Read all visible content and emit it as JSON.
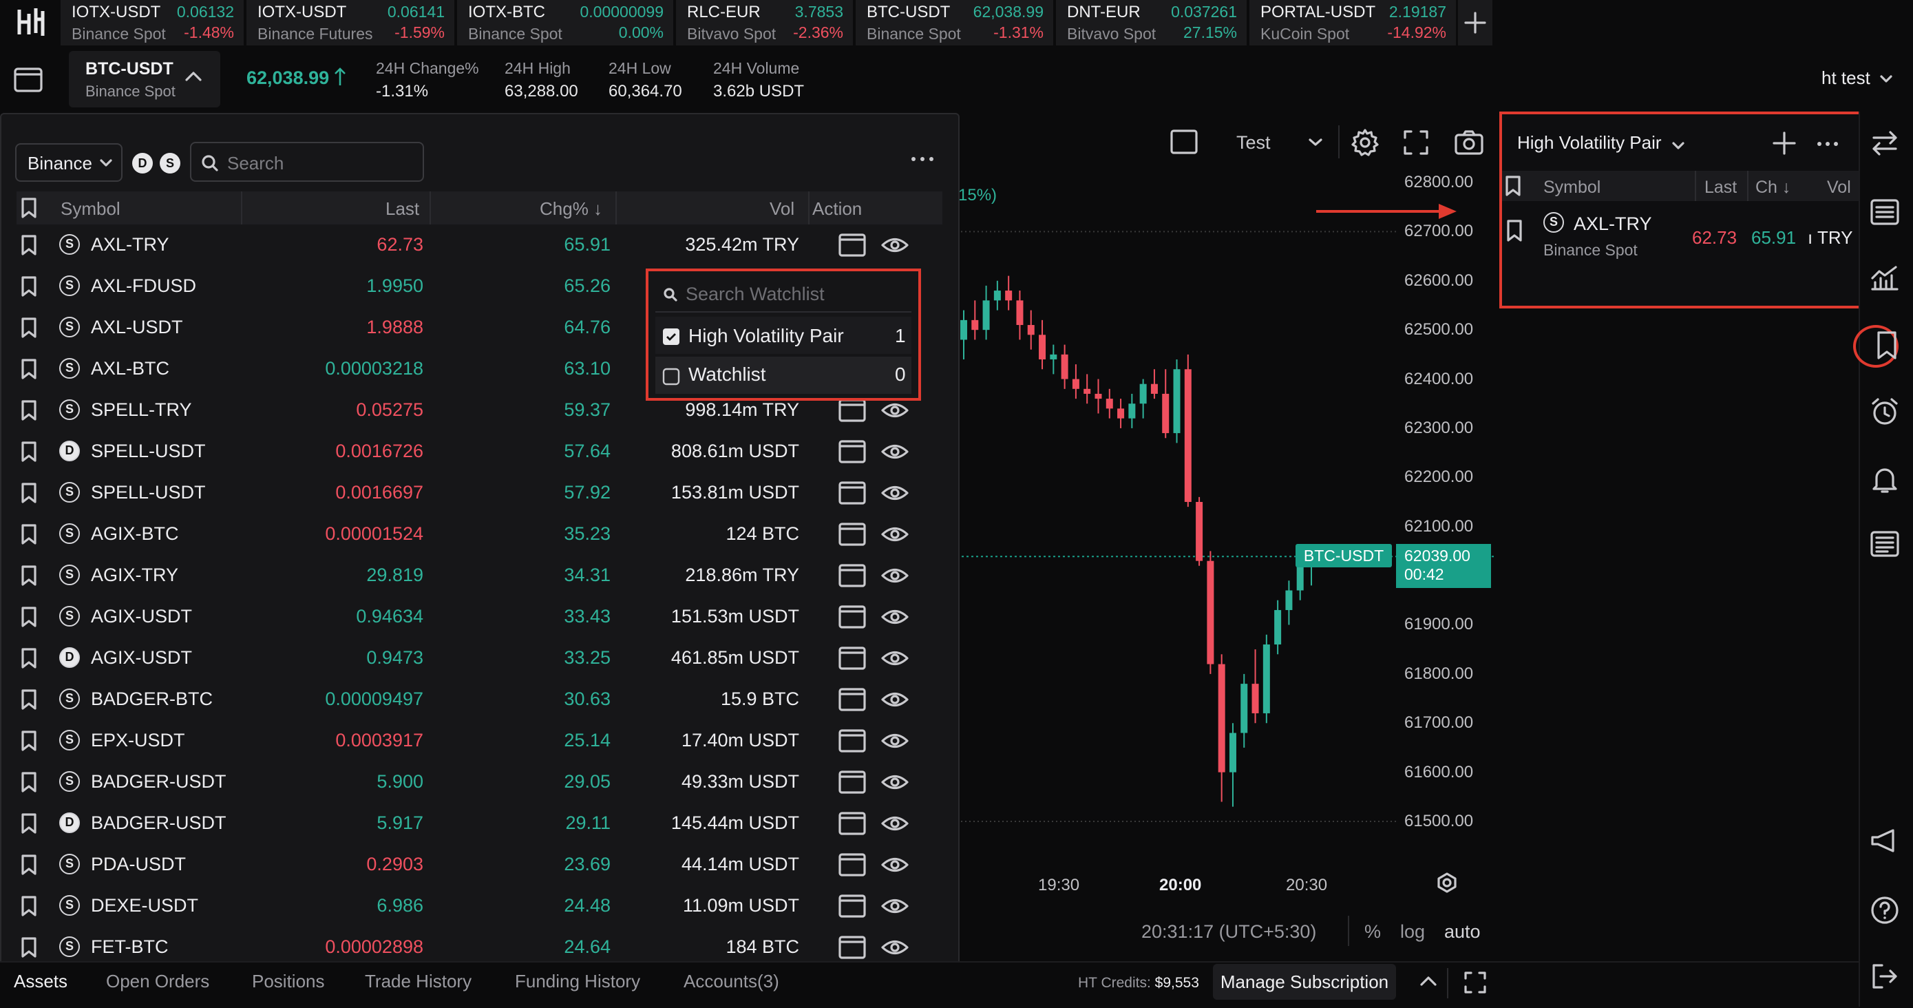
{
  "tickers": [
    {
      "name": "IOTX-USDT",
      "price": "0.06132",
      "exchange": "Binance Spot",
      "change": "-1.48%",
      "dir": "down"
    },
    {
      "name": "IOTX-USDT",
      "price": "0.06141",
      "exchange": "Binance Futures",
      "change": "-1.59%",
      "dir": "down"
    },
    {
      "name": "IOTX-BTC",
      "price": "0.00000099",
      "exchange": "Binance Spot",
      "change": "0.00%",
      "dir": "up"
    },
    {
      "name": "RLC-EUR",
      "price": "3.7853",
      "exchange": "Bitvavo Spot",
      "change": "-2.36%",
      "dir": "down"
    },
    {
      "name": "BTC-USDT",
      "price": "62,038.99",
      "exchange": "Binance Spot",
      "change": "-1.31%",
      "dir": "down"
    },
    {
      "name": "DNT-EUR",
      "price": "0.037261",
      "exchange": "Bitvavo Spot",
      "change": "27.15%",
      "dir": "up"
    },
    {
      "name": "PORTAL-USDT",
      "price": "2.19187",
      "exchange": "KuCoin Spot",
      "change": "-14.92%",
      "dir": "down"
    }
  ],
  "header": {
    "pair": "BTC-USDT",
    "pair_exchange": "Binance Spot",
    "price": "62,038.99",
    "stats": [
      {
        "label": "24H Change%",
        "value": "-1.31%"
      },
      {
        "label": "24H High",
        "value": "63,288.00"
      },
      {
        "label": "24H Low",
        "value": "60,364.70"
      },
      {
        "label": "24H Volume",
        "value": "3.62b USDT"
      }
    ],
    "user": "ht test"
  },
  "market": {
    "exchange": "Binance",
    "badge_d": "D",
    "badge_s": "S",
    "search_placeholder": "Search",
    "columns": {
      "symbol": "Symbol",
      "last": "Last",
      "chg": "Chg% ↓",
      "vol": "Vol",
      "action": "Action"
    },
    "rows": [
      {
        "src": "S",
        "symbol": "AXL-TRY",
        "last": "62.73",
        "last_dir": "down",
        "chg": "65.91",
        "vol": "325.42m TRY"
      },
      {
        "src": "S",
        "symbol": "AXL-FDUSD",
        "last": "1.9950",
        "last_dir": "up",
        "chg": "65.26",
        "vol": ""
      },
      {
        "src": "S",
        "symbol": "AXL-USDT",
        "last": "1.9888",
        "last_dir": "down",
        "chg": "64.76",
        "vol": ""
      },
      {
        "src": "S",
        "symbol": "AXL-BTC",
        "last": "0.00003218",
        "last_dir": "up",
        "chg": "63.10",
        "vol": ""
      },
      {
        "src": "S",
        "symbol": "SPELL-TRY",
        "last": "0.05275",
        "last_dir": "down",
        "chg": "59.37",
        "vol": "998.14m TRY"
      },
      {
        "src": "D",
        "symbol": "SPELL-USDT",
        "last": "0.0016726",
        "last_dir": "down",
        "chg": "57.64",
        "vol": "808.61m USDT"
      },
      {
        "src": "S",
        "symbol": "SPELL-USDT",
        "last": "0.0016697",
        "last_dir": "down",
        "chg": "57.92",
        "vol": "153.81m USDT"
      },
      {
        "src": "S",
        "symbol": "AGIX-BTC",
        "last": "0.00001524",
        "last_dir": "down",
        "chg": "35.23",
        "vol": "124 BTC"
      },
      {
        "src": "S",
        "symbol": "AGIX-TRY",
        "last": "29.819",
        "last_dir": "up",
        "chg": "34.31",
        "vol": "218.86m TRY"
      },
      {
        "src": "S",
        "symbol": "AGIX-USDT",
        "last": "0.94634",
        "last_dir": "up",
        "chg": "33.43",
        "vol": "151.53m USDT"
      },
      {
        "src": "D",
        "symbol": "AGIX-USDT",
        "last": "0.9473",
        "last_dir": "up",
        "chg": "33.25",
        "vol": "461.85m USDT"
      },
      {
        "src": "S",
        "symbol": "BADGER-BTC",
        "last": "0.00009497",
        "last_dir": "up",
        "chg": "30.63",
        "vol": "15.9 BTC"
      },
      {
        "src": "S",
        "symbol": "EPX-USDT",
        "last": "0.0003917",
        "last_dir": "down",
        "chg": "25.14",
        "vol": "17.40m USDT"
      },
      {
        "src": "S",
        "symbol": "BADGER-USDT",
        "last": "5.900",
        "last_dir": "up",
        "chg": "29.05",
        "vol": "49.33m USDT"
      },
      {
        "src": "D",
        "symbol": "BADGER-USDT",
        "last": "5.917",
        "last_dir": "up",
        "chg": "29.11",
        "vol": "145.44m USDT"
      },
      {
        "src": "S",
        "symbol": "PDA-USDT",
        "last": "0.2903",
        "last_dir": "down",
        "chg": "23.69",
        "vol": "44.14m USDT"
      },
      {
        "src": "S",
        "symbol": "DEXE-USDT",
        "last": "6.986",
        "last_dir": "up",
        "chg": "24.48",
        "vol": "11.09m USDT"
      },
      {
        "src": "S",
        "symbol": "FET-BTC",
        "last": "0.00002898",
        "last_dir": "down",
        "chg": "24.64",
        "vol": "184 BTC"
      }
    ]
  },
  "watchlist_popup": {
    "search_placeholder": "Search Watchlist",
    "items": [
      {
        "label": "High Volatility Pair",
        "count": "1",
        "checked": true
      },
      {
        "label": "Watchlist",
        "count": "0",
        "checked": false
      }
    ]
  },
  "chart_toolbar": {
    "layout_name": "Test"
  },
  "chart_data": {
    "type": "candlestick",
    "symbol": "BTC-USDT",
    "y_ticks": [
      "62800.00",
      "62700.00",
      "62600.00",
      "62500.00",
      "62400.00",
      "62300.00",
      "62200.00",
      "62100.00",
      "61900.00",
      "61800.00",
      "61700.00",
      "61600.00",
      "61500.00"
    ],
    "ylim": [
      61470,
      62830
    ],
    "x_ticks": [
      "19:30",
      "20:00",
      "20:30"
    ],
    "current_price": "62039.00",
    "countdown": "00:42",
    "partial_label": "15%)",
    "ohlc": [
      [
        62480,
        62540,
        62440,
        62520
      ],
      [
        62520,
        62560,
        62480,
        62500
      ],
      [
        62500,
        62590,
        62480,
        62560
      ],
      [
        62560,
        62600,
        62540,
        62580
      ],
      [
        62580,
        62610,
        62540,
        62560
      ],
      [
        62560,
        62580,
        62480,
        62510
      ],
      [
        62510,
        62540,
        62460,
        62490
      ],
      [
        62490,
        62520,
        62420,
        62440
      ],
      [
        62440,
        62470,
        62410,
        62450
      ],
      [
        62450,
        62470,
        62380,
        62400
      ],
      [
        62400,
        62430,
        62360,
        62380
      ],
      [
        62380,
        62410,
        62350,
        62370
      ],
      [
        62370,
        62400,
        62330,
        62360
      ],
      [
        62360,
        62380,
        62320,
        62340
      ],
      [
        62340,
        62360,
        62300,
        62320
      ],
      [
        62320,
        62370,
        62300,
        62350
      ],
      [
        62350,
        62400,
        62320,
        62390
      ],
      [
        62390,
        62420,
        62360,
        62370
      ],
      [
        62370,
        62420,
        62280,
        62290
      ],
      [
        62290,
        62440,
        62270,
        62420
      ],
      [
        62420,
        62450,
        62140,
        62150
      ],
      [
        62150,
        62160,
        62020,
        62030
      ],
      [
        62030,
        62050,
        61800,
        61820
      ],
      [
        61820,
        61840,
        61540,
        61600
      ],
      [
        61600,
        61700,
        61530,
        61680
      ],
      [
        61680,
        61800,
        61650,
        61780
      ],
      [
        61780,
        61850,
        61700,
        61720
      ],
      [
        61720,
        61880,
        61700,
        61860
      ],
      [
        61860,
        61950,
        61840,
        61930
      ],
      [
        61930,
        61990,
        61900,
        61970
      ],
      [
        61970,
        62040,
        61950,
        62030
      ],
      [
        62030,
        62050,
        61980,
        62039
      ]
    ],
    "time_readout": "20:31:17 (UTC+5:30)",
    "scale_options": [
      "%",
      "log",
      "auto"
    ]
  },
  "right_panel": {
    "watchlist_name": "High Volatility Pair",
    "columns": {
      "symbol": "Symbol",
      "last": "Last",
      "chg": "Ch ↓",
      "vol": "Vol"
    },
    "row": {
      "src": "S",
      "symbol": "AXL-TRY",
      "exchange": "Binance Spot",
      "last": "62.73",
      "chg": "65.91",
      "vol": "ı TRY"
    }
  },
  "bottom": {
    "tabs": [
      "Assets",
      "Open Orders",
      "Positions",
      "Trade History",
      "Funding History",
      "Accounts(3)"
    ],
    "credits_label": "HT Credits:",
    "credits_value": "$9,553",
    "manage": "Manage Subscription"
  },
  "colors": {
    "up": "#2fb39a",
    "down": "#f0505f",
    "highlight": "#e03a2f"
  }
}
